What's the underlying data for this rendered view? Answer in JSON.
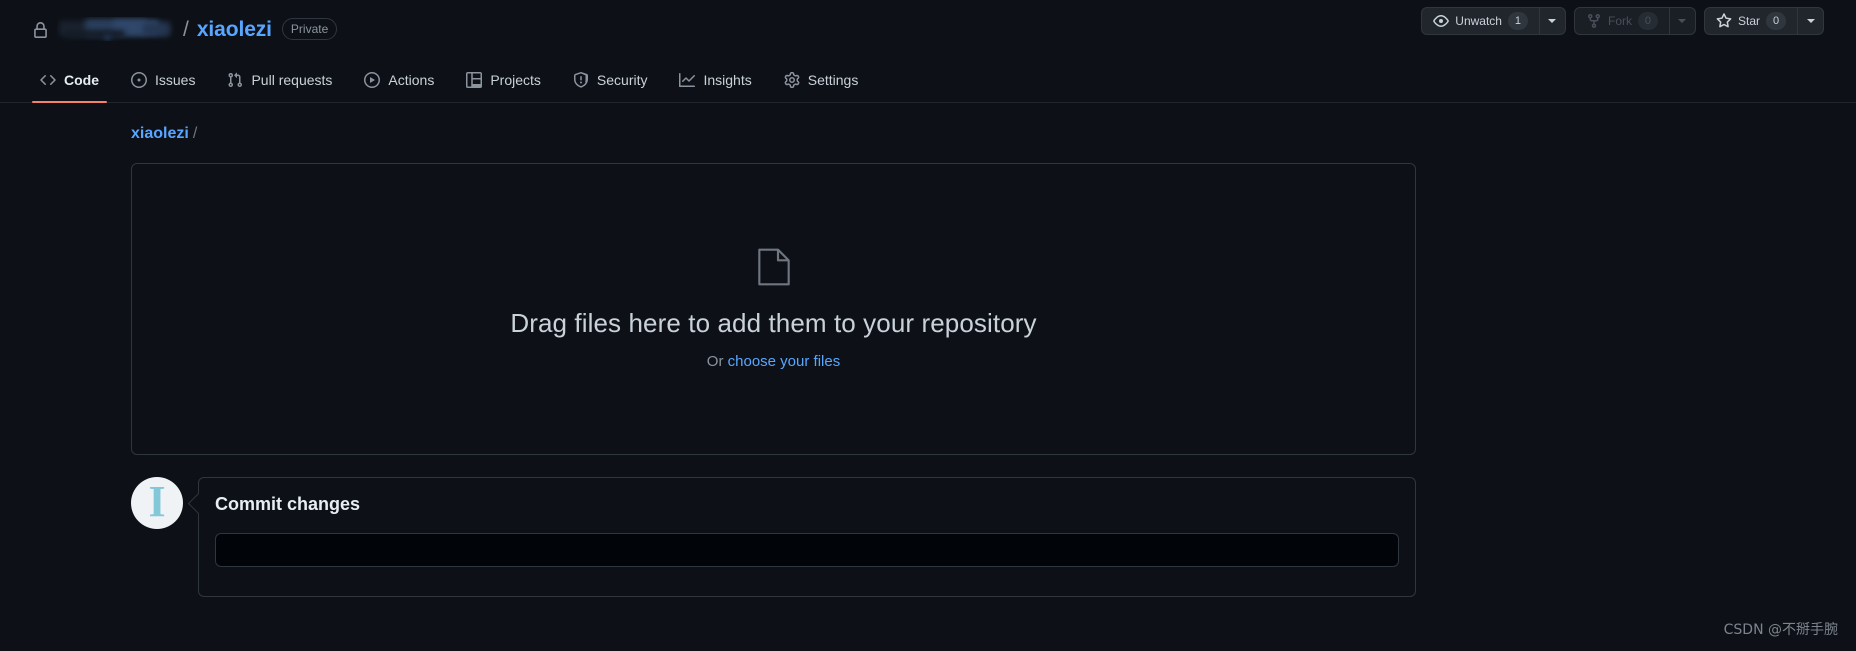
{
  "header": {
    "lock_icon": "lock-icon",
    "owner_redacted": true,
    "separator": "/",
    "repo_name": "xiaolezi",
    "visibility": "Private",
    "actions": [
      {
        "icon": "eye-icon",
        "label": "Unwatch",
        "count": "1",
        "disabled": false,
        "has_caret": true
      },
      {
        "icon": "fork-icon",
        "label": "Fork",
        "count": "0",
        "disabled": true,
        "has_caret": true
      },
      {
        "icon": "star-icon",
        "label": "Star",
        "count": "0",
        "disabled": false,
        "has_caret": true
      }
    ]
  },
  "nav": {
    "items": [
      {
        "label": "Code",
        "icon": "code-icon",
        "selected": true
      },
      {
        "label": "Issues",
        "icon": "issue-icon",
        "selected": false
      },
      {
        "label": "Pull requests",
        "icon": "pr-icon",
        "selected": false
      },
      {
        "label": "Actions",
        "icon": "play-icon",
        "selected": false
      },
      {
        "label": "Projects",
        "icon": "table-icon",
        "selected": false
      },
      {
        "label": "Security",
        "icon": "shield-icon",
        "selected": false
      },
      {
        "label": "Insights",
        "icon": "graph-icon",
        "selected": false
      },
      {
        "label": "Settings",
        "icon": "gear-icon",
        "selected": false
      }
    ]
  },
  "breadcrumb": {
    "repo": "xiaolezi",
    "separator": "/"
  },
  "dropzone": {
    "icon": "file-icon",
    "title": "Drag files here to add them to your repository",
    "sub_prefix": "Or ",
    "sub_link": "choose your files"
  },
  "commit": {
    "avatar_glyph": "I",
    "title": "Commit changes",
    "message_placeholder": ""
  },
  "watermark": "CSDN @不掰手腕",
  "colors": {
    "background": "#0d1117",
    "border": "#30363d",
    "link": "#58a6ff",
    "text": "#c9d1d9",
    "muted": "#8b949e",
    "active_tab_underline": "#f78166",
    "button_bg": "#21262d",
    "avatar_bg": "#f0f3f6",
    "avatar_glyph": "#84c7d9"
  }
}
